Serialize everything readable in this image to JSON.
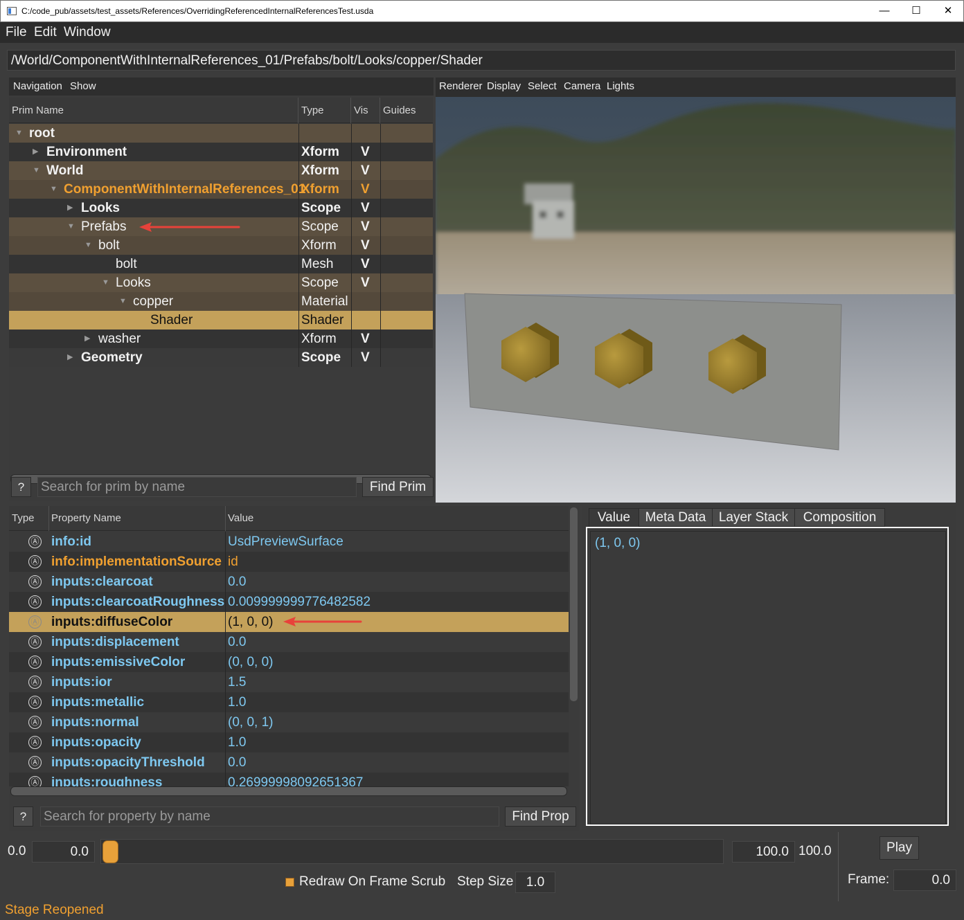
{
  "window": {
    "title": "C:/code_pub/assets/test_assets/References/OverridingReferencedInternalReferencesTest.usda",
    "minimize": "—",
    "maximize": "☐",
    "close": "✕"
  },
  "menubar": [
    "File",
    "Edit",
    "Window"
  ],
  "path": "/World/ComponentWithInternalReferences_01/Prefabs/bolt/Looks/copper/Shader",
  "navigation": {
    "menu": [
      "Navigation",
      "Show"
    ],
    "columns": [
      "Prim Name",
      "Type",
      "Vis",
      "Guides"
    ],
    "rows": [
      {
        "name": "root",
        "type": "",
        "vis": ""
      },
      {
        "name": "Environment",
        "type": "Xform",
        "vis": "V"
      },
      {
        "name": "World",
        "type": "Xform",
        "vis": "V"
      },
      {
        "name": "ComponentWithInternalReferences_01",
        "type": "Xform",
        "vis": "V"
      },
      {
        "name": "Looks",
        "type": "Scope",
        "vis": "V"
      },
      {
        "name": "Prefabs",
        "type": "Scope",
        "vis": "V"
      },
      {
        "name": "bolt",
        "type": "Xform",
        "vis": "V"
      },
      {
        "name": "bolt",
        "type": "Mesh",
        "vis": "V"
      },
      {
        "name": "Looks",
        "type": "Scope",
        "vis": "V"
      },
      {
        "name": "copper",
        "type": "Material",
        "vis": ""
      },
      {
        "name": "Shader",
        "type": "Shader",
        "vis": ""
      },
      {
        "name": "washer",
        "type": "Xform",
        "vis": "V"
      },
      {
        "name": "Geometry",
        "type": "Scope",
        "vis": "V"
      }
    ],
    "search_help": "?",
    "search_placeholder": "Search for prim by name",
    "find_label": "Find Prim"
  },
  "viewport": {
    "menu": [
      "Renderer",
      "Display",
      "Select",
      "Camera",
      "Lights"
    ]
  },
  "properties": {
    "columns": [
      "Type",
      "Property Name",
      "Value"
    ],
    "type_icon": "Ⓐ",
    "rows": [
      {
        "name": "info:id",
        "value": "UsdPreviewSurface"
      },
      {
        "name": "info:implementationSource",
        "value": "id"
      },
      {
        "name": "inputs:clearcoat",
        "value": "0.0"
      },
      {
        "name": "inputs:clearcoatRoughness",
        "value": "0.009999999776482582"
      },
      {
        "name": "inputs:diffuseColor",
        "value": "(1, 0, 0)"
      },
      {
        "name": "inputs:displacement",
        "value": "0.0"
      },
      {
        "name": "inputs:emissiveColor",
        "value": "(0, 0, 0)"
      },
      {
        "name": "inputs:ior",
        "value": "1.5"
      },
      {
        "name": "inputs:metallic",
        "value": "1.0"
      },
      {
        "name": "inputs:normal",
        "value": "(0, 0, 1)"
      },
      {
        "name": "inputs:opacity",
        "value": "1.0"
      },
      {
        "name": "inputs:opacityThreshold",
        "value": "0.0"
      },
      {
        "name": "inputs:roughness",
        "value": "0.26999998092651367"
      }
    ],
    "search_help": "?",
    "search_placeholder": "Search for property by name",
    "find_label": "Find Prop"
  },
  "value_panel": {
    "tabs": [
      "Value",
      "Meta Data",
      "Layer Stack",
      "Composition"
    ],
    "value": "(1, 0, 0)"
  },
  "timeline": {
    "start_label": "0.0",
    "start_field": "0.0",
    "end_field": "100.0",
    "end_label": "100.0",
    "play_label": "Play",
    "redraw_label": "Redraw On Frame Scrub",
    "step_label": "Step Size",
    "step_value": "1.0",
    "frame_label": "Frame:",
    "frame_value": "0.0"
  },
  "status": "Stage Reopened",
  "colors": {
    "accent": "#f0a030",
    "selection": "#c4a15a",
    "value_blue": "#7ec8f0",
    "annotation_arrow": "#e8423a"
  }
}
